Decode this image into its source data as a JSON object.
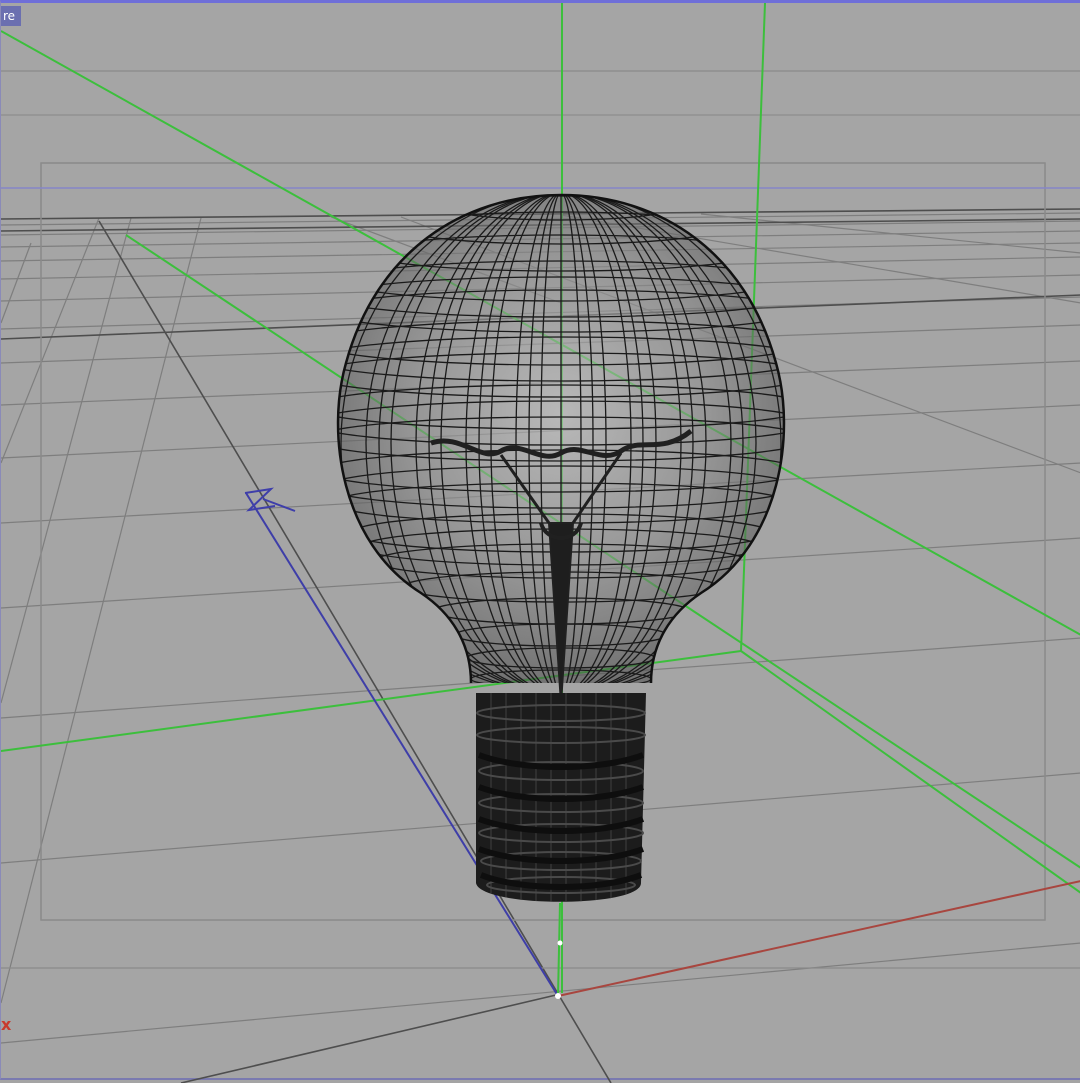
{
  "viewport": {
    "label": "re",
    "mode": "wireframe",
    "object": "light bulb mesh"
  },
  "colors": {
    "background": "#a5a5a5",
    "grid": "#7d7d7d",
    "grid_major": "#5a5a5a",
    "bounding_box": "#3fbf3f",
    "axis_x": "#b04a44",
    "axis_y": "#3fbf3f",
    "axis_z": "#3e3eaa",
    "mesh": "#1b1b1b",
    "safe_frame": "#8a8a8a"
  },
  "axes": {
    "x_label": "x",
    "z_glyph": "Z"
  },
  "icons": [
    "viewport-menu-icon",
    "axis-gizmo-icon"
  ]
}
